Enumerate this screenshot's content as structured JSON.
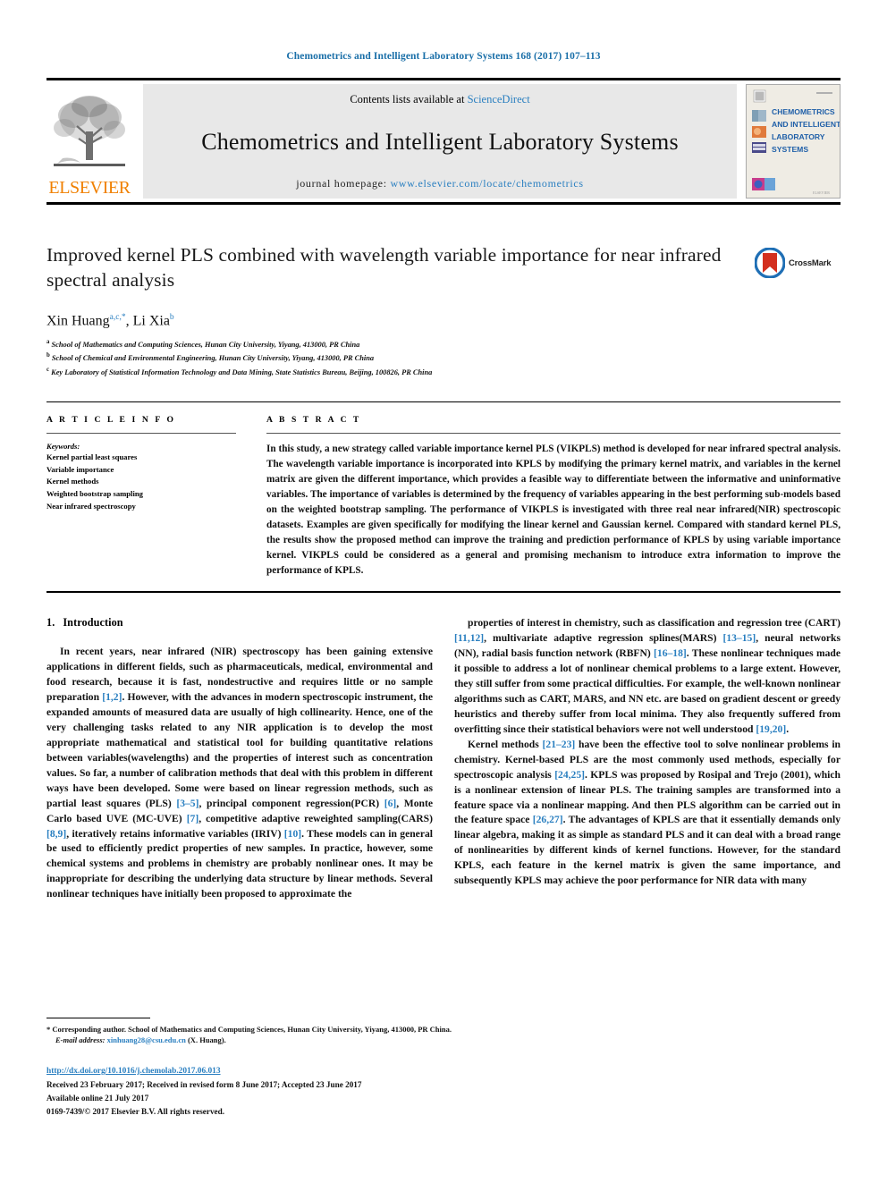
{
  "running_head": "Chemometrics and Intelligent Laboratory Systems 168 (2017) 107–113",
  "masthead": {
    "publisher_name": "ELSEVIER",
    "contents_prefix": "Contents lists available at",
    "contents_link": "ScienceDirect",
    "journal_title": "Chemometrics and Intelligent Laboratory Systems",
    "homepage_label": "journal homepage:",
    "homepage_url": "www.elsevier.com/locate/chemometrics",
    "cover_lines": [
      "CHEMOMETRICS",
      "AND INTELLIGENT",
      "LABORATORY",
      "SYSTEMS"
    ],
    "cover_footer": "ELSEVIER"
  },
  "article": {
    "title": "Improved kernel PLS combined with wavelength variable importance for near infrared spectral analysis",
    "crossmark_label": "CrossMark",
    "authors": [
      {
        "name": "Xin Huang",
        "sup": "a,c,",
        "star": "*"
      },
      {
        "name": "Li Xia",
        "sup": "b",
        "star": ""
      }
    ],
    "affiliations": [
      {
        "mark": "a",
        "text": "School of Mathematics and Computing Sciences, Hunan City University, Yiyang, 413000, PR China"
      },
      {
        "mark": "b",
        "text": "School of Chemical and Environmental Engineering, Hunan City University, Yiyang, 413000, PR China"
      },
      {
        "mark": "c",
        "text": "Key Laboratory of Statistical Information Technology and Data Mining, State Statistics Bureau, Beijing, 100826, PR China"
      }
    ]
  },
  "article_info": {
    "heading": "A R T I C L E  I N F O",
    "keywords_label": "Keywords:",
    "keywords": [
      "Kernel partial least squares",
      "Variable importance",
      "Kernel methods",
      "Weighted bootstrap sampling",
      "Near infrared spectroscopy"
    ]
  },
  "abstract": {
    "heading": "A B S T R A C T",
    "text": "In this study, a new strategy called variable importance kernel PLS (VIKPLS) method is developed for near infrared spectral analysis. The wavelength variable importance is incorporated into KPLS by modifying the primary kernel matrix, and variables in the kernel matrix are given the different importance, which provides a feasible way to differentiate between the informative and uninformative variables. The importance of variables is determined by the frequency of variables appearing in the best performing sub-models based on the weighted bootstrap sampling. The performance of VIKPLS is investigated with three real near infrared(NIR) spectroscopic datasets. Examples are given specifically for modifying the linear kernel and Gaussian kernel. Compared with standard kernel PLS, the results show the proposed method can improve the training and prediction performance of KPLS by using variable importance kernel. VIKPLS could be considered as a general and promising mechanism to introduce extra information to improve the performance of KPLS."
  },
  "introduction": {
    "number": "1.",
    "title": "Introduction",
    "left_paragraphs": [
      "In recent years, near infrared (NIR) spectroscopy has been gaining extensive applications in different fields, such as pharmaceuticals, medical, environmental and food research, because it is fast, nondestructive and requires little or no sample preparation [1,2]. However, with the advances in modern spectroscopic instrument, the expanded amounts of measured data are usually of high collinearity. Hence, one of the very challenging tasks related to any NIR application is to develop the most appropriate mathematical and statistical tool for building quantitative relations between variables(wavelengths) and the properties of interest such as concentration values. So far, a number of calibration methods that deal with this problem in different ways have been developed. Some were based on linear regression methods, such as partial least squares (PLS) [3–5], principal component regression(PCR) [6], Monte Carlo based UVE (MC-UVE) [7], competitive adaptive reweighted sampling(CARS) [8,9], iteratively retains informative variables (IRIV) [10]. These models can in general be used to efficiently predict properties of new samples. In practice, however, some chemical systems and problems in chemistry are probably nonlinear ones. It may be inappropriate for describing the underlying data structure by linear methods. Several nonlinear techniques have initially been proposed to approximate the"
    ],
    "right_paragraphs": [
      "properties of interest in chemistry, such as classification and regression tree (CART) [11,12], multivariate adaptive regression splines(MARS) [13–15], neural networks (NN), radial basis function network (RBFN) [16–18]. These nonlinear techniques made it possible to address a lot of nonlinear chemical problems to a large extent. However, they still suffer from some practical difficulties. For example, the well-known nonlinear algorithms such as CART, MARS, and NN etc. are based on gradient descent or greedy heuristics and thereby suffer from local minima. They also frequently suffered from overfitting since their statistical behaviors were not well understood [19,20].",
      "Kernel methods [21–23] have been the effective tool to solve nonlinear problems in chemistry. Kernel-based PLS are the most commonly used methods, especially for spectroscopic analysis [24,25]. KPLS was proposed by Rosipal and Trejo (2001), which is a nonlinear extension of linear PLS. The training samples are transformed into a feature space via a nonlinear mapping. And then PLS algorithm can be carried out in the feature space [26,27]. The advantages of KPLS are that it essentially demands only linear algebra, making it as simple as standard PLS and it can deal with a broad range of nonlinearities by different kinds of kernel functions. However, for the standard KPLS, each feature in the kernel matrix is given the same importance, and subsequently KPLS may achieve the poor performance for NIR data with many"
    ]
  },
  "footnote": {
    "star": "*",
    "corresponding": "Corresponding author. School of Mathematics and Computing Sciences, Hunan City University, Yiyang, 413000, PR China.",
    "email_label": "E-mail address:",
    "email": "xinhuang28@csu.edu.cn",
    "email_suffix": "(X. Huang)."
  },
  "footer": {
    "doi": "http://dx.doi.org/10.1016/j.chemolab.2017.06.013",
    "dates": "Received 23 February 2017; Received in revised form 8 June 2017; Accepted 23 June 2017",
    "available": "Available online 21 July 2017",
    "copyright": "0169-7439/© 2017 Elsevier B.V. All rights reserved."
  },
  "colors": {
    "link_blue": "#2a7fc0",
    "header_blue": "#1a6fa8",
    "elsevier_orange": "#f08000",
    "crossmark_red": "#d32f1e",
    "crossmark_blue": "#1f6fb5"
  }
}
